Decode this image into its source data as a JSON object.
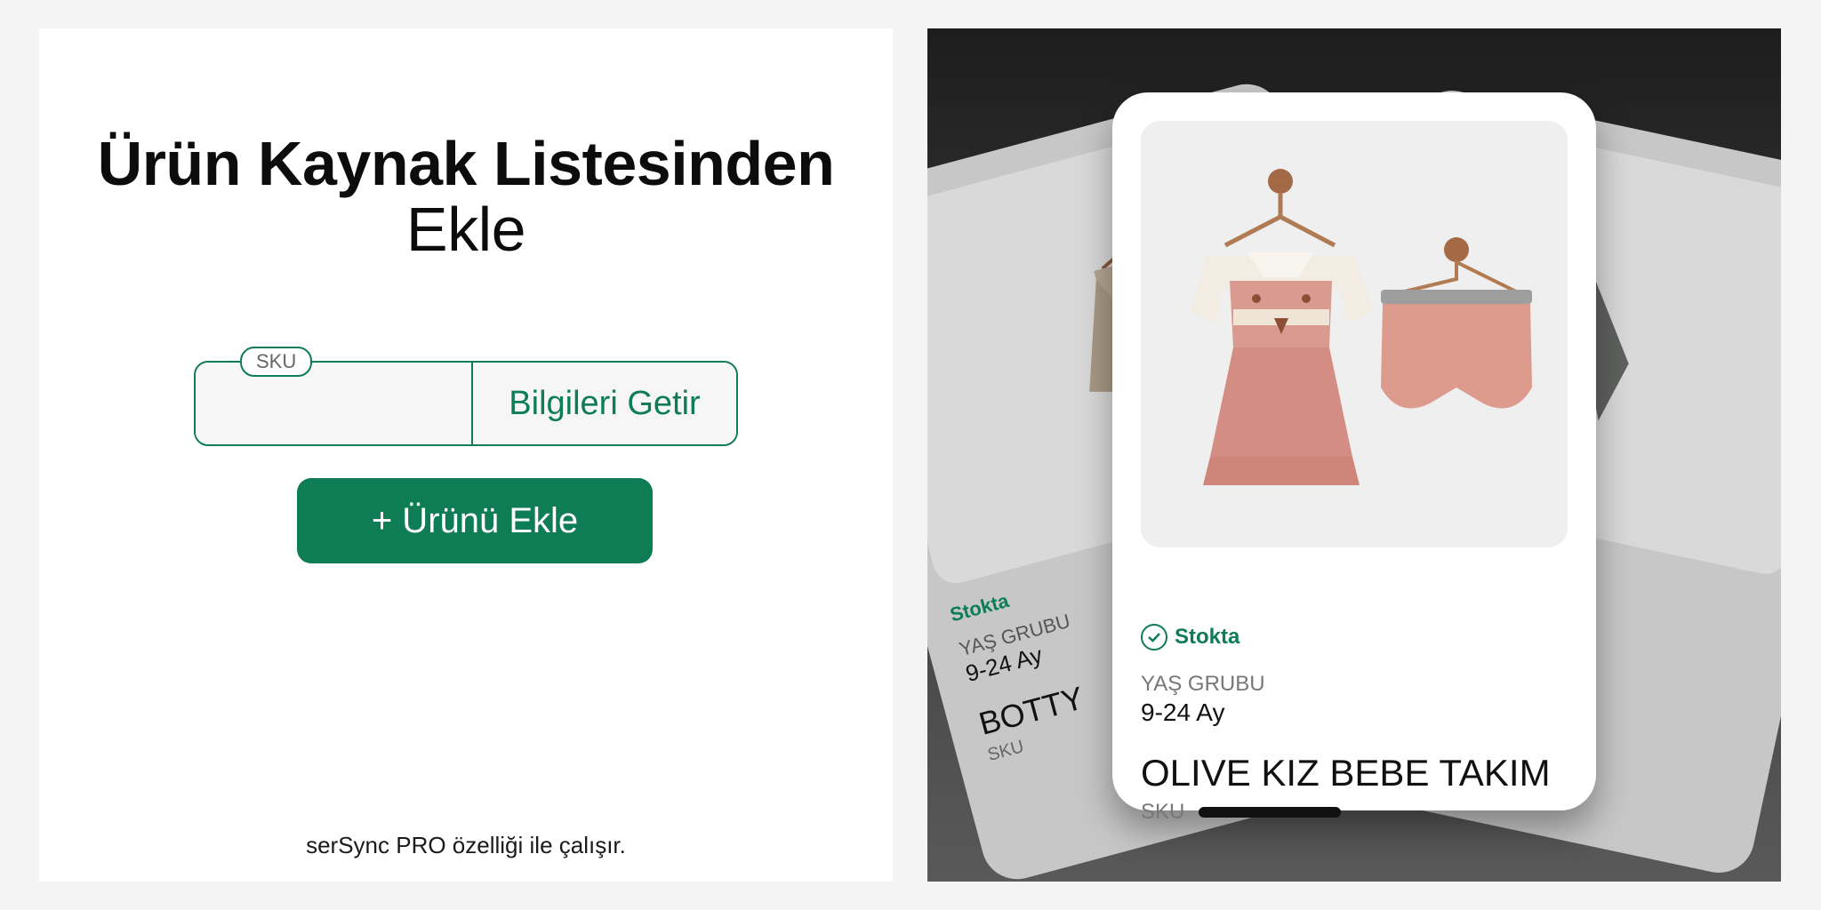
{
  "left_panel": {
    "title_bold": "Ürün Kaynak Listesinden",
    "title_normal": "Ekle",
    "sku_label": "SKU",
    "sku_input_value": "",
    "fetch_button_label": "Bilgileri Getir",
    "add_button_label": "+ Ürünü Ekle",
    "footer_note": "serSync PRO özelliği ile çalışır."
  },
  "right_panel": {
    "main_card": {
      "stock_label": "Stokta",
      "age_group_label": "YAŞ GRUBU",
      "age_group_value": "9-24 Ay",
      "product_name": "OLIVE KIZ BEBE TAKIM",
      "sku_label": "SKU"
    },
    "back_card_left": {
      "stock_label": "Stokta",
      "age_group_label": "YAŞ GRUBU",
      "age_group_value": "9-24 Ay",
      "product_name": "BOTTY",
      "sku_label": "SKU"
    }
  },
  "colors": {
    "accent": "#0e7c55",
    "dark_bg": "#1d1d1d"
  }
}
